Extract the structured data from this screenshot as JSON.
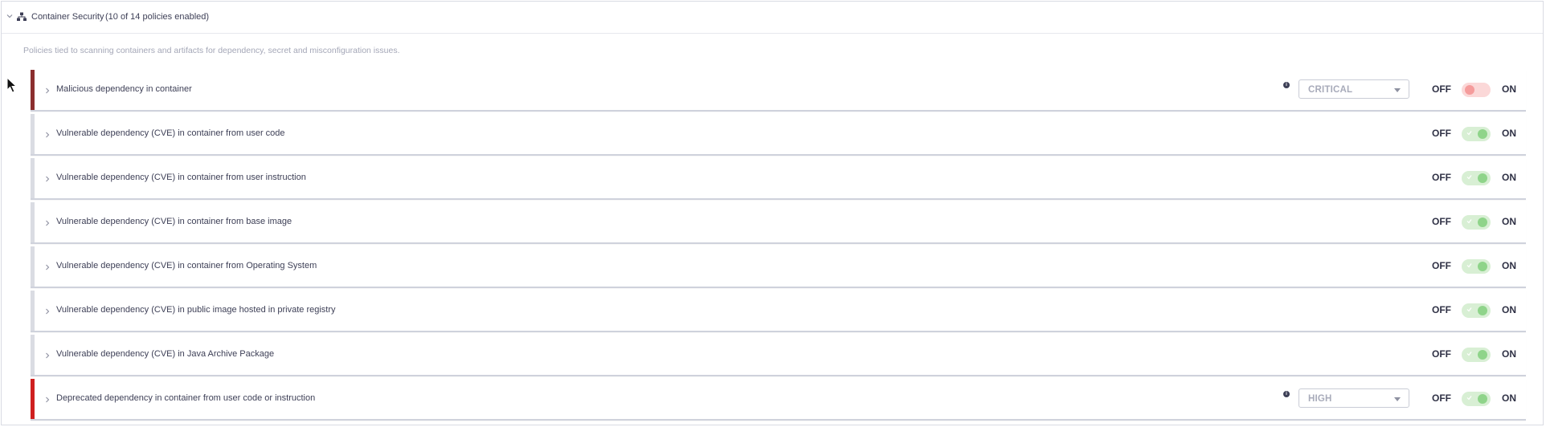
{
  "section": {
    "title": "Container Security",
    "count_text": "(10 of 14 policies enabled)",
    "description": "Policies tied to scanning containers and artifacts for dependency, secret and misconfiguration issues.",
    "icons": {
      "collapse": "chevron-down-icon",
      "section": "sitemap-icon"
    }
  },
  "toggle_labels": {
    "off": "OFF",
    "on": "ON"
  },
  "colors": {
    "critical_stripe": "#8b2e2e",
    "high_stripe": "#cf1f1f",
    "neutral_stripe": "#dadce3",
    "toggle_on": "#8fd48a",
    "toggle_off": "#f59c9c"
  },
  "policies": [
    {
      "label": "Malicious dependency in container",
      "severity": "CRITICAL",
      "enabled": false
    },
    {
      "label": "Vulnerable dependency (CVE) in container from user code",
      "severity": "",
      "enabled": true
    },
    {
      "label": "Vulnerable dependency (CVE) in container from user instruction",
      "severity": "",
      "enabled": true
    },
    {
      "label": "Vulnerable dependency (CVE) in container from base image",
      "severity": "",
      "enabled": true
    },
    {
      "label": "Vulnerable dependency (CVE) in container from Operating System",
      "severity": "",
      "enabled": true
    },
    {
      "label": "Vulnerable dependency (CVE) in public image hosted in private registry",
      "severity": "",
      "enabled": true
    },
    {
      "label": "Vulnerable dependency (CVE) in Java Archive Package",
      "severity": "",
      "enabled": true
    },
    {
      "label": "Deprecated dependency in container from user code or instruction",
      "severity": "HIGH",
      "enabled": true
    }
  ]
}
